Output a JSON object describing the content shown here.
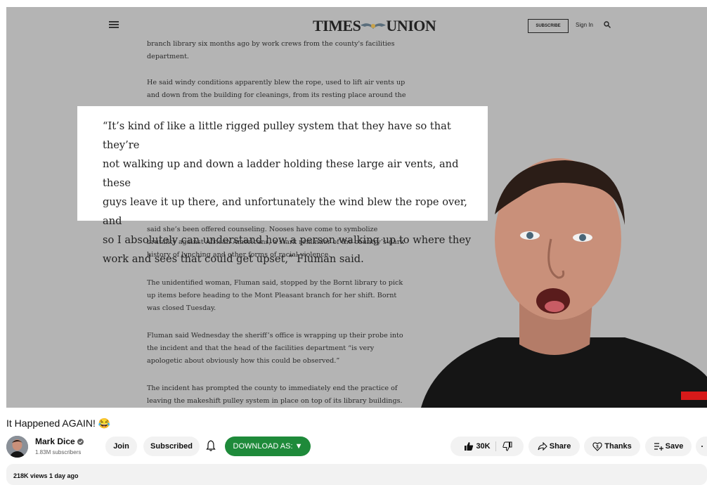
{
  "article": {
    "logo": "TIMES UNION",
    "subscribe": "SUBSCRIBE",
    "sign_in": "Sign In",
    "lines_top": [
      "branch library six months ago by work crews from the county's facilities",
      "department."
    ],
    "para_wind": [
      "He said windy conditions apparently blew the rope, used to lift air vents up",
      "and down from the building for cleanings, from its resting place around the"
    ],
    "quote": [
      "“It’s kind of  like a little rigged pulley system that they have so that they’re",
      "not walking up and down a ladder holding these large air vents, and these",
      "guys leave it up there, and unfortunately the wind blew the rope over, and",
      "so I absolutely can understand how  a person walking up to where they",
      "work and sees that could get upset,” Fluman said."
    ],
    "para_counsel": [
      "said she’s been offered counseling. Nooses have come to symbolize",
      "brutality against African Americans, a stark reminder of the country’s dark",
      "history of lynching and other forms of racial violence."
    ],
    "para_woman": [
      "The unidentified woman, Fluman said, stopped by the Bornt library to pick",
      "up items before heading to the Mont Pleasant branch for her shift. Bornt",
      "was closed Tuesday."
    ],
    "para_sheriff": [
      "Fluman said Wednesday the sheriff’s office is wrapping up their probe into",
      "the incident and that the head of the facilities department “is very",
      "apologetic about obviously how this could be observed.”"
    ],
    "para_incident": [
      "The incident has prompted the county to immediately end the practice of",
      "leaving the makeshift pulley system in place on top of its library buildings."
    ]
  },
  "video": {
    "title": "It Happened AGAIN! 😂",
    "channel_name": "Mark Dice",
    "subscribers": "1.83M subscribers",
    "join": "Join",
    "subscribed": "Subscribed",
    "download": "DOWNLOAD AS: ▼",
    "likes": "30K",
    "share": "Share",
    "thanks": "Thanks",
    "save": "Save",
    "views": "218K views  1 day ago"
  },
  "colors": {
    "download_bg": "#1e8a3a",
    "pill_bg": "#f2f2f2",
    "video_bg": "#b4b4b4"
  }
}
